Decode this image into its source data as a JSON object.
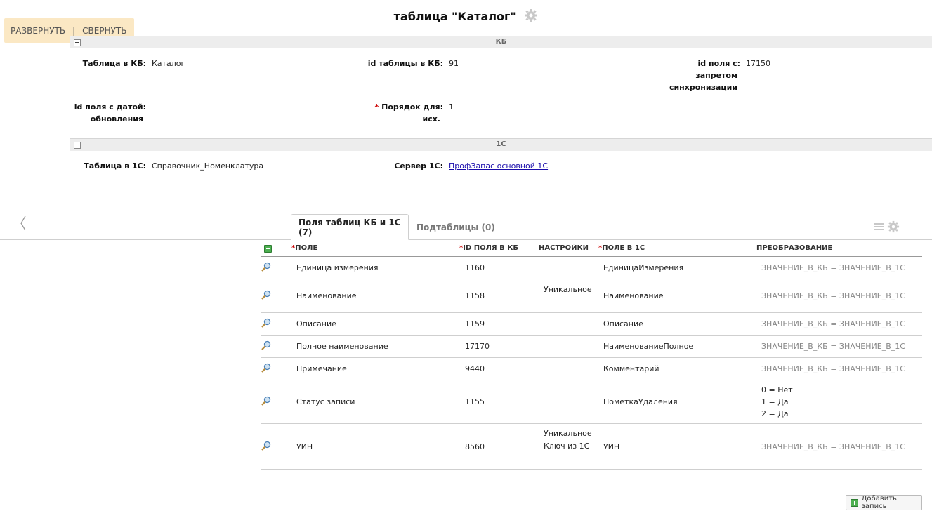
{
  "header": {
    "title": "таблица \"Каталог\"",
    "gear_icon": "gear-icon"
  },
  "expand": {
    "expand_label": "РАЗВЕРНУТЬ",
    "separator": "|",
    "collapse_label": "СВЕРНУТЬ"
  },
  "sections": {
    "kb": {
      "title": "КБ",
      "fields": {
        "table_label": "Таблица в КБ:",
        "table_value": "Каталог",
        "id_label": "id таблицы в КБ:",
        "id_value": "91",
        "ban_label_1": "id поля с:",
        "ban_label_2": "запретом",
        "ban_label_3": "синхронизации",
        "ban_value": "17150",
        "date_label_1": "id поля с датой:",
        "date_label_2": "обновления",
        "order_req": "*",
        "order_label_1": "Порядок для:",
        "order_label_2": "исх.",
        "order_value": "1"
      }
    },
    "onec": {
      "title": "1С",
      "fields": {
        "table_label": "Таблица в 1С:",
        "table_value": "Справочник_Номенклатура",
        "server_label": "Сервер 1С:",
        "server_value": "ПрофЗапас основной 1С"
      }
    }
  },
  "tabs": [
    {
      "label": "Поля таблиц КБ и 1С (7)",
      "active": true
    },
    {
      "label": "Подтаблицы (0)",
      "active": false
    }
  ],
  "grid": {
    "headers": {
      "field_req": "*",
      "field": "ПОЛЕ",
      "id_req": "*",
      "id": "ID ПОЛЯ В КБ",
      "settings": "НАСТРОЙКИ",
      "onec_req": "*",
      "onec": "ПОЛЕ В 1С",
      "conversion": "ПРЕОБРАЗОВАНИЕ"
    },
    "rows": [
      {
        "field": "Единица измерения",
        "id": "1160",
        "settings_1": "",
        "settings_2": "",
        "onec": "ЕдиницаИзмерения",
        "conv_1": "ЗНАЧЕНИЕ_В_КБ = ЗНАЧЕНИЕ_В_1С",
        "conv_2": "",
        "conv_3": ""
      },
      {
        "field": "Наименование",
        "id": "1158",
        "settings_1": "Уникальное",
        "settings_2": "",
        "onec": "Наименование",
        "conv_1": "ЗНАЧЕНИЕ_В_КБ = ЗНАЧЕНИЕ_В_1С",
        "conv_2": "",
        "conv_3": ""
      },
      {
        "field": "Описание",
        "id": "1159",
        "settings_1": "",
        "settings_2": "",
        "onec": "Описание",
        "conv_1": "ЗНАЧЕНИЕ_В_КБ = ЗНАЧЕНИЕ_В_1С",
        "conv_2": "",
        "conv_3": ""
      },
      {
        "field": "Полное наименование",
        "id": "17170",
        "settings_1": "",
        "settings_2": "",
        "onec": "НаименованиеПолное",
        "conv_1": "ЗНАЧЕНИЕ_В_КБ = ЗНАЧЕНИЕ_В_1С",
        "conv_2": "",
        "conv_3": ""
      },
      {
        "field": "Примечание",
        "id": "9440",
        "settings_1": "",
        "settings_2": "",
        "onec": "Комментарий",
        "conv_1": "ЗНАЧЕНИЕ_В_КБ = ЗНАЧЕНИЕ_В_1С",
        "conv_2": "",
        "conv_3": ""
      },
      {
        "field": "Статус записи",
        "id": "1155",
        "settings_1": "",
        "settings_2": "",
        "onec": "ПометкаУдаления",
        "conv_1": "0 = Нет",
        "conv_2": "1 = Да",
        "conv_3": "2 = Да"
      },
      {
        "field": "УИН",
        "id": "8560",
        "settings_1": "Уникальное",
        "settings_2": "Ключ из 1С",
        "onec": "УИН",
        "conv_1": "ЗНАЧЕНИЕ_В_КБ = ЗНАЧЕНИЕ_В_1С",
        "conv_2": "",
        "conv_3": ""
      }
    ]
  },
  "add_record": {
    "label": "Добавить запись"
  },
  "colors": {
    "expand_bg": "#fbe8c4",
    "add_green": "#4caf50",
    "link": "#1a0dab",
    "required": "#cc0000"
  }
}
